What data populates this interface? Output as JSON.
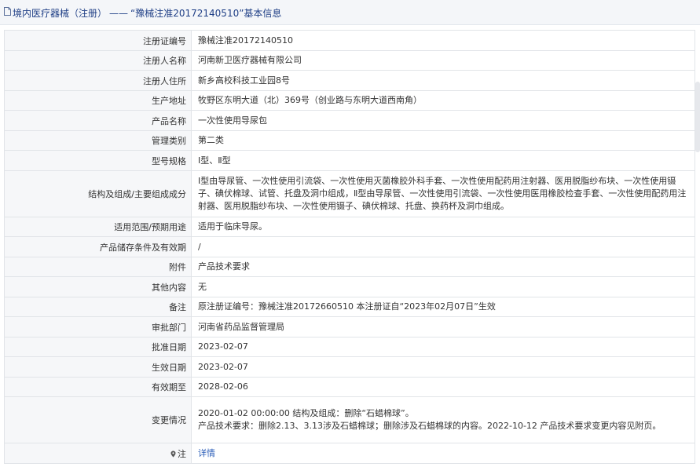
{
  "breadcrumb": {
    "section": "境内医疗器械（注册）",
    "separator": "——",
    "current": "“豫械注准20172140510”基本信息"
  },
  "rows": [
    {
      "label": "注册证编号",
      "value": "豫械注准20172140510"
    },
    {
      "label": "注册人名称",
      "value": "河南新卫医疗器械有限公司"
    },
    {
      "label": "注册人住所",
      "value": "新乡高校科技工业园8号"
    },
    {
      "label": "生产地址",
      "value": "牧野区东明大道（北）369号（创业路与东明大道西南角）"
    },
    {
      "label": "产品名称",
      "value": "一次性使用导尿包"
    },
    {
      "label": "管理类别",
      "value": "第二类"
    },
    {
      "label": "型号规格",
      "value": "Ⅰ型、Ⅱ型"
    },
    {
      "label": "结构及组成/主要组成成分",
      "value": "Ⅰ型由导尿管、一次性使用引流袋、一次性使用灭菌橡胶外科手套、一次性使用配药用注射器、医用脱脂纱布块、一次性使用镊子、碘伏棉球、试管、托盘及洞巾组成，Ⅱ型由导尿管、一次性使用引流袋、一次性使用医用橡胶检查手套、一次性使用配药用注射器、医用脱脂纱布块、一次性使用镊子、碘伏棉球、托盘、换药杯及洞巾组成。"
    },
    {
      "label": "适用范围/预期用途",
      "value": "适用于临床导尿。"
    },
    {
      "label": "产品储存条件及有效期",
      "value": "/"
    },
    {
      "label": "附件",
      "value": "产品技术要求"
    },
    {
      "label": "其他内容",
      "value": "无"
    },
    {
      "label": "备注",
      "value": "原注册证编号：豫械注准20172660510 本注册证自“2023年02月07日”生效"
    },
    {
      "label": "审批部门",
      "value": "河南省药品监督管理局"
    },
    {
      "label": "批准日期",
      "value": "2023-02-07"
    },
    {
      "label": "生效日期",
      "value": "2023-02-07"
    },
    {
      "label": "有效期至",
      "value": "2028-02-06"
    }
  ],
  "change_row": {
    "label": "变更情况",
    "line1": "2020-01-02 00:00:00 结构及组成：删除“石蜡棉球”。",
    "line2": "产品技术要求：删除2.13、3.13涉及石蜡棉球；删除涉及石蜡棉球的内容。2022-10-12 产品技术要求变更内容见附页。"
  },
  "note_row": {
    "label": "注",
    "link": "详情"
  }
}
